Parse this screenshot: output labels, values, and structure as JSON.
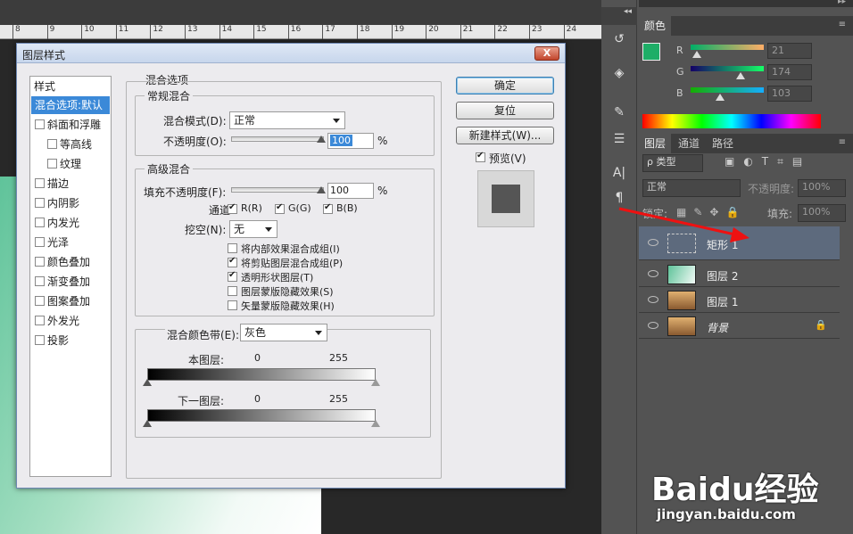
{
  "ruler": {
    "ticks": [
      "8",
      "9",
      "10",
      "11",
      "12",
      "13",
      "14",
      "15",
      "16",
      "17",
      "18",
      "19",
      "20",
      "21",
      "22",
      "23",
      "24"
    ]
  },
  "dialog": {
    "title": "图层样式",
    "close": "X",
    "styles_header": "样式",
    "styles": [
      {
        "label": "混合选项:默认",
        "checkbox": false,
        "selected": true,
        "sub": false
      },
      {
        "label": "斜面和浮雕",
        "checkbox": true,
        "checked": false,
        "sub": false
      },
      {
        "label": "等高线",
        "checkbox": true,
        "checked": false,
        "sub": true
      },
      {
        "label": "纹理",
        "checkbox": true,
        "checked": false,
        "sub": true
      },
      {
        "label": "描边",
        "checkbox": true,
        "checked": false,
        "sub": false
      },
      {
        "label": "内阴影",
        "checkbox": true,
        "checked": false,
        "sub": false
      },
      {
        "label": "内发光",
        "checkbox": true,
        "checked": false,
        "sub": false
      },
      {
        "label": "光泽",
        "checkbox": true,
        "checked": false,
        "sub": false
      },
      {
        "label": "颜色叠加",
        "checkbox": true,
        "checked": false,
        "sub": false
      },
      {
        "label": "渐变叠加",
        "checkbox": true,
        "checked": false,
        "sub": false
      },
      {
        "label": "图案叠加",
        "checkbox": true,
        "checked": false,
        "sub": false
      },
      {
        "label": "外发光",
        "checkbox": true,
        "checked": false,
        "sub": false
      },
      {
        "label": "投影",
        "checkbox": true,
        "checked": false,
        "sub": false
      }
    ],
    "blend_options": "混合选项",
    "general": {
      "title": "常规混合",
      "mode_label": "混合模式(D):",
      "mode_value": "正常",
      "opacity_label": "不透明度(O):",
      "opacity_value": "100",
      "percent": "%"
    },
    "advanced": {
      "title": "高级混合",
      "fill_label": "填充不透明度(F):",
      "fill_value": "100",
      "percent": "%",
      "channels_label": "通道:",
      "channels": [
        "R(R)",
        "G(G)",
        "B(B)"
      ],
      "knockout_label": "挖空(N):",
      "knockout_value": "无",
      "options": [
        {
          "label": "将内部效果混合成组(I)",
          "checked": false
        },
        {
          "label": "将剪贴图层混合成组(P)",
          "checked": true
        },
        {
          "label": "透明形状图层(T)",
          "checked": true
        },
        {
          "label": "图层蒙版隐藏效果(S)",
          "checked": false
        },
        {
          "label": "矢量蒙版隐藏效果(H)",
          "checked": false
        }
      ]
    },
    "blend_if": {
      "label": "混合颜色带(E):",
      "value": "灰色",
      "this_layer": "本图层:",
      "this_min": "0",
      "this_max": "255",
      "underlying": "下一图层:",
      "under_min": "0",
      "under_max": "255"
    },
    "buttons": {
      "ok": "确定",
      "reset": "复位",
      "new_style": "新建样式(W)...",
      "preview": "预览(V)"
    },
    "preview_checked": true
  },
  "panels": {
    "collapse": "◂◂",
    "expand": "▸▸",
    "color_tab": "颜色",
    "foreground_color": "#1eae67",
    "rgb": [
      {
        "label": "R",
        "value": "21"
      },
      {
        "label": "G",
        "value": "174"
      },
      {
        "label": "B",
        "value": "103"
      }
    ],
    "layers_tabs": [
      "图层",
      "通道",
      "路径"
    ],
    "filter_label": "ρ 类型",
    "blend_mode": "正常",
    "opacity_label": "不透明度:",
    "opacity_value": "100%",
    "lock_label": "锁定:",
    "fill_label": "填充:",
    "fill_value": "100%",
    "layers": [
      {
        "name": "矩形 1",
        "selected": true,
        "kind": "shape"
      },
      {
        "name": "图层 2",
        "selected": false,
        "kind": "gradient"
      },
      {
        "name": "图层 1",
        "selected": false,
        "kind": "photo"
      },
      {
        "name": "背景",
        "selected": false,
        "kind": "photo",
        "locked": true
      }
    ]
  },
  "watermark": {
    "brand": "Baidu经验",
    "url": "jingyan.baidu.com"
  }
}
